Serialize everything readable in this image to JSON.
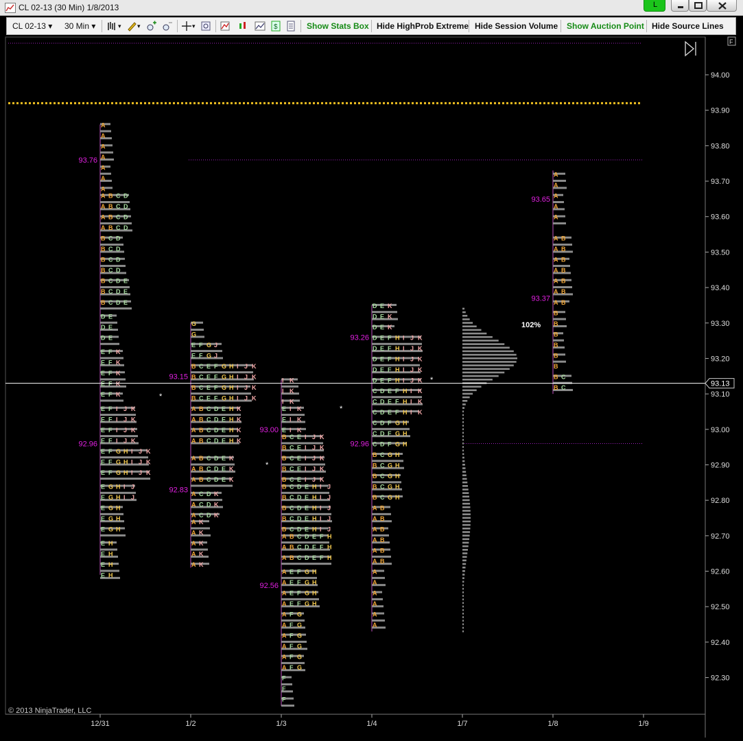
{
  "window": {
    "title": "CL 02-13 (30 Min)  1/8/2013",
    "live_badge": "L"
  },
  "toolbar": {
    "instrument": "CL 02-13",
    "interval": "30 Min",
    "buttons": [
      "Show Stats Box",
      "Hide HighProb Extreme",
      "Hide Session Volume",
      "Show Auction Point",
      "Hide Source Lines"
    ]
  },
  "chart": {
    "copyright": "© 2013 NinjaTrader, LLC",
    "pct_label": "102%",
    "current_price": "93.13",
    "panel_label": "F"
  },
  "chart_data": {
    "type": "market-profile",
    "y_ticks": [
      94.0,
      93.9,
      93.8,
      93.7,
      93.6,
      93.5,
      93.4,
      93.3,
      93.2,
      93.1,
      93.0,
      92.9,
      92.8,
      92.7,
      92.6,
      92.5,
      92.4,
      92.3
    ],
    "x_ticks": [
      "12/31",
      "1/2",
      "1/3",
      "1/4",
      "1/7",
      "1/8",
      "1/9"
    ],
    "current_price": 93.13,
    "reference_lines": [
      93.92,
      93.76,
      92.96
    ],
    "colors": {
      "A": "#f2a83a",
      "B": "#f2a83a",
      "C": "#a8dca0",
      "D": "#a8dca0",
      "E": "#a8dca0",
      "F": "#a8dca0",
      "G": "#f2c84e",
      "H": "#f2c84e",
      "I": "#f4a8a8",
      "J": "#f4a8a8",
      "K": "#f4a8a8",
      "red": "#ff3333",
      "value_label": "#e020e0",
      "hist": "#8c8c8c"
    },
    "sessions": [
      {
        "date": "12/31",
        "high": 93.86,
        "low": 92.59,
        "price_labels": [
          {
            "text": "93.76",
            "price": 93.76
          },
          {
            "text": "92.96",
            "price": 92.96
          }
        ],
        "tpo_blocks": [
          {
            "from": 93.86,
            "to": 93.68,
            "letters": "A"
          },
          {
            "from": 93.66,
            "to": 93.56,
            "letters": "ABCD"
          },
          {
            "from": 93.54,
            "to": 93.44,
            "letters": "BCD"
          },
          {
            "from": 93.42,
            "to": 93.34,
            "letters": "BCDE"
          },
          {
            "from": 93.32,
            "to": 93.24,
            "letters": "DE"
          },
          {
            "from": 93.22,
            "to": 93.08,
            "letters": "EFK"
          },
          {
            "from": 93.06,
            "to": 92.96,
            "letters": "EFIJK"
          },
          {
            "from": 92.94,
            "to": 92.86,
            "letters": "EFGHIJK"
          },
          {
            "from": 92.84,
            "to": 92.8,
            "letters": "EGHIJ"
          },
          {
            "from": 92.78,
            "to": 92.7,
            "letters": "EGH"
          },
          {
            "from": 92.68,
            "to": 92.59,
            "letters": "EH"
          }
        ]
      },
      {
        "date": "1/2",
        "high": 93.3,
        "low": 92.61,
        "price_labels": [
          {
            "text": "93.15",
            "price": 93.15
          },
          {
            "text": "92.83",
            "price": 92.83
          }
        ],
        "tpo_blocks": [
          {
            "from": 93.3,
            "to": 93.27,
            "letters": "G"
          },
          {
            "from": 93.24,
            "to": 93.21,
            "letters": "EFGJ"
          },
          {
            "from": 93.18,
            "to": 93.08,
            "letters": "BCEFGHIJK"
          },
          {
            "from": 93.06,
            "to": 92.95,
            "letters": "ABCDEHK"
          },
          {
            "from": 92.92,
            "to": 92.84,
            "letters": "ABCDEK"
          },
          {
            "from": 92.82,
            "to": 92.76,
            "letters": "ACDK"
          },
          {
            "from": 92.74,
            "to": 92.61,
            "letters": "AK"
          }
        ]
      },
      {
        "date": "1/3",
        "high": 93.14,
        "low": 92.22,
        "price_labels": [
          {
            "text": "93.00",
            "price": 93.0
          },
          {
            "text": "92.56",
            "price": 92.56
          }
        ],
        "tpo_blocks": [
          {
            "from": 93.14,
            "to": 93.08,
            "letters": "IK"
          },
          {
            "from": 93.06,
            "to": 93.0,
            "letters": "EIK"
          },
          {
            "from": 92.98,
            "to": 92.86,
            "letters": "BCEIJK"
          },
          {
            "from": 92.84,
            "to": 92.72,
            "letters": "BCDEHIJ"
          },
          {
            "from": 92.7,
            "to": 92.62,
            "letters": "ABCDEFH"
          },
          {
            "from": 92.6,
            "to": 92.5,
            "letters": "AEFGH"
          },
          {
            "from": 92.48,
            "to": 92.32,
            "letters": "AFG"
          },
          {
            "from": 92.3,
            "to": 92.22,
            "letters": "F"
          }
        ]
      },
      {
        "date": "1/4",
        "high": 93.35,
        "low": 92.43,
        "price_labels": [
          {
            "text": "93.26",
            "price": 93.26
          },
          {
            "text": "92.96",
            "price": 92.96
          }
        ],
        "tpo_blocks": [
          {
            "from": 93.35,
            "to": 93.29,
            "letters": "DEK"
          },
          {
            "from": 93.26,
            "to": 93.14,
            "letters": "DEFHIJK"
          },
          {
            "from": 93.11,
            "to": 93.05,
            "letters": "CDEFHIK"
          },
          {
            "from": 93.02,
            "to": 92.96,
            "letters": "CDFGH"
          },
          {
            "from": 92.93,
            "to": 92.81,
            "letters": "BCGH"
          },
          {
            "from": 92.78,
            "to": 92.63,
            "letters": "AB"
          },
          {
            "from": 92.6,
            "to": 92.43,
            "letters": "A"
          }
        ]
      },
      {
        "date": "1/7",
        "high": 93.34,
        "low": 92.42,
        "price_labels": [],
        "tpo_blocks": []
      },
      {
        "date": "1/8",
        "high": 93.73,
        "low": 93.1,
        "price_labels": [
          {
            "text": "93.65",
            "price": 93.65
          },
          {
            "text": "93.37",
            "price": 93.37
          }
        ],
        "tpo_blocks": [
          {
            "from": 93.72,
            "to": 93.58,
            "letters": "A"
          },
          {
            "from": 93.54,
            "to": 93.36,
            "letters": "AB"
          },
          {
            "from": 93.33,
            "to": 93.18,
            "letters": "B"
          },
          {
            "from": 93.15,
            "to": 93.11,
            "letters": "BC"
          }
        ]
      }
    ]
  }
}
